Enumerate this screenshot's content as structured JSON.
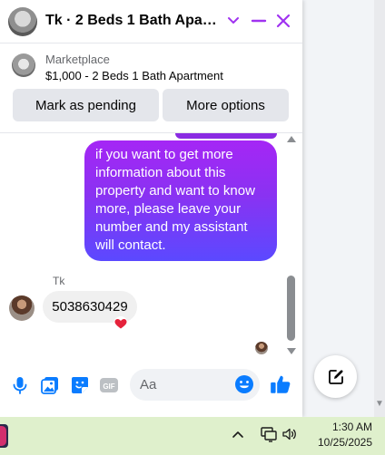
{
  "header": {
    "title": "Tk · 2 Beds 1 Bath Apartment",
    "title_display": "Tk · 2 Beds 1 Bath Apartm..."
  },
  "marketplace": {
    "label": "Marketplace",
    "listing": "$1,000 - 2 Beds 1 Bath Apartment",
    "mark_pending_label": "Mark as pending",
    "more_options_label": "More options"
  },
  "messages": {
    "outgoing_text": "if you want to get more information about this property and want to know more, please leave your number and my assistant will contact.",
    "sender_name": "Tk",
    "incoming_text": "5038630429",
    "reaction": "heart"
  },
  "composer": {
    "placeholder": "Aa",
    "icons": [
      "microphone-icon",
      "photo-icon",
      "sticker-icon",
      "gif-icon",
      "emoji-icon",
      "thumbs-up-icon"
    ],
    "gif_label": "GIF"
  },
  "taskbar": {
    "time": "1:30 AM",
    "date": "10/25/2025"
  },
  "colors": {
    "accent": "#0a7cff",
    "bubble_top": "#a526f5",
    "bubble_bottom": "#5b49ff",
    "taskbar": "#dff0cc"
  }
}
